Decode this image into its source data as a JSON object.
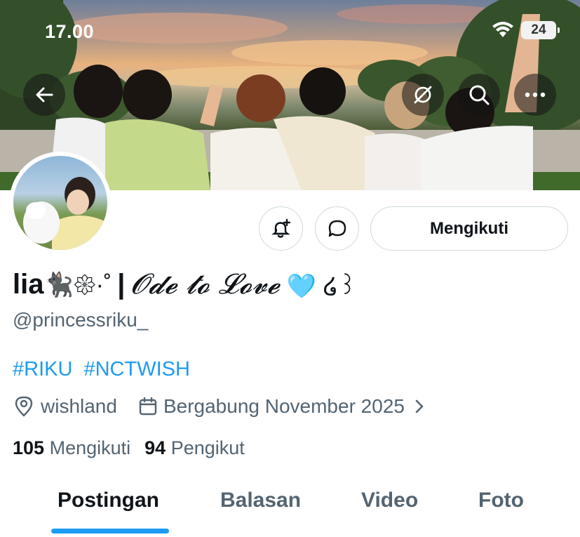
{
  "status_bar": {
    "time": "17.00",
    "battery": "24"
  },
  "profile": {
    "display_name": "lia",
    "display_name_emoji": "🐈‍⬛𑁍·˚",
    "separator": "|",
    "display_name_text": "𝓞𝓭𝓮 𝓽𝓸 𝓛𝓸𝓿𝓮",
    "display_name_tail": "🩵 ໒꒱",
    "handle": "@princessriku_",
    "bio_tags": [
      "#RIKU",
      "#NCTWISH"
    ],
    "location": "wishland",
    "joined": "Bergabung November 2025",
    "following_count": "105",
    "following_label": "Mengikuti",
    "followers_count": "94",
    "followers_label": "Pengikut"
  },
  "actions": {
    "follow_label": "Mengikuti"
  },
  "tabs": [
    {
      "label": "Postingan",
      "active": true
    },
    {
      "label": "Balasan",
      "active": false
    },
    {
      "label": "Video",
      "active": false
    },
    {
      "label": "Foto",
      "active": false
    }
  ],
  "icons": {
    "back": "arrow-left-icon",
    "hide": "eye-slash-icon",
    "search": "search-icon",
    "more": "more-icon",
    "notify": "bell-plus-icon",
    "message": "chat-bubble-icon",
    "location": "location-pin-icon",
    "calendar": "calendar-icon",
    "chevron": "chevron-right-icon",
    "wifi": "wifi-icon"
  },
  "colors": {
    "accent": "#1d9bf0",
    "text": "#0f1419",
    "secondary": "#536471",
    "border": "#cfd9de"
  }
}
